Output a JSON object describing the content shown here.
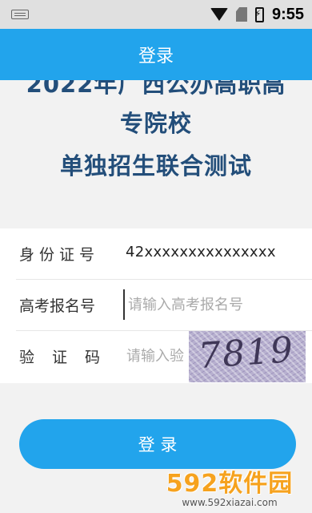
{
  "status_bar": {
    "time": "9:55"
  },
  "app_bar": {
    "title": "登录"
  },
  "banner": {
    "line1": "2022年广西公办高职高",
    "line2": "专院校",
    "line3": "单独招生联合测试"
  },
  "form": {
    "id_label": "身份证号",
    "id_value": "42xxxxxxxxxxxxxxx",
    "exam_label": "高考报名号",
    "exam_placeholder": "请输入高考报名号",
    "captcha_label": "验证码",
    "captcha_placeholder": "请输入验",
    "captcha_image_text": "7819"
  },
  "login_button": "登 录",
  "watermark": {
    "logo": "592软件园",
    "url": "www.592xiazai.com"
  },
  "colors": {
    "accent": "#22a4ec",
    "banner_text": "#234e7a",
    "watermark": "#f6a21e"
  }
}
